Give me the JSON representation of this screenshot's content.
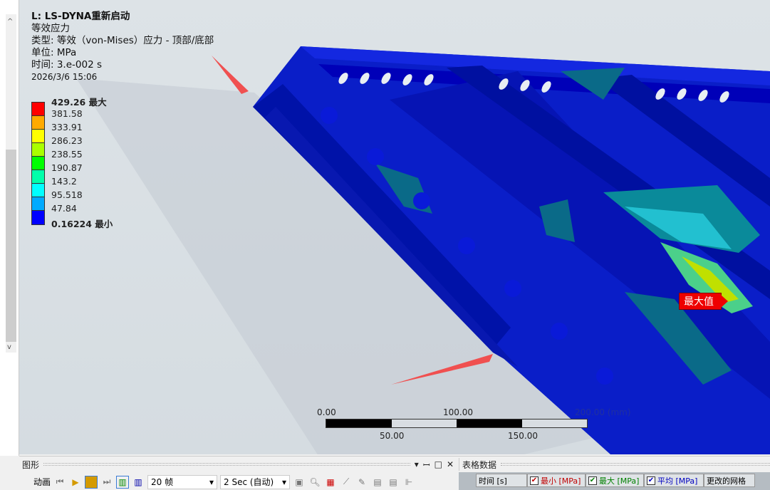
{
  "info": {
    "title": "L: LS-DYNA重新启动",
    "result": "等效应力",
    "type": "类型: 等效（von-Mises）应力 - 顶部/底部",
    "unit": "单位: MPa",
    "time": "时间: 3.e-002 s",
    "date": "2026/3/6 15:06"
  },
  "legend": {
    "labels": [
      "429.26 最大",
      "381.58",
      "333.91",
      "286.23",
      "238.55",
      "190.87",
      "143.2",
      "95.518",
      "47.84",
      "0.16224 最小"
    ],
    "colors": [
      "#ff0000",
      "#ffaa00",
      "#ffff00",
      "#aaff00",
      "#00ff00",
      "#00ffaa",
      "#00ffff",
      "#00aaff",
      "#0000ff"
    ]
  },
  "scale": {
    "top": [
      "0.00",
      "100.00",
      "200.00 (mm)"
    ],
    "bottom": [
      "50.00",
      "150.00"
    ]
  },
  "max_tag": "最大值",
  "graphics_panel": {
    "title": "图形",
    "animation_label": "动画",
    "frames": "20 帧",
    "duration": "2 Sec (自动)"
  },
  "table_panel": {
    "title": "表格数据",
    "columns": [
      "时间 [s]",
      "最小 [MPa]",
      "最大 [MPa]",
      "平均 [MPa]",
      "更改的网格"
    ],
    "column_colors": [
      "#222",
      "#c00000",
      "#008000",
      "#0000c0",
      "#222"
    ]
  }
}
